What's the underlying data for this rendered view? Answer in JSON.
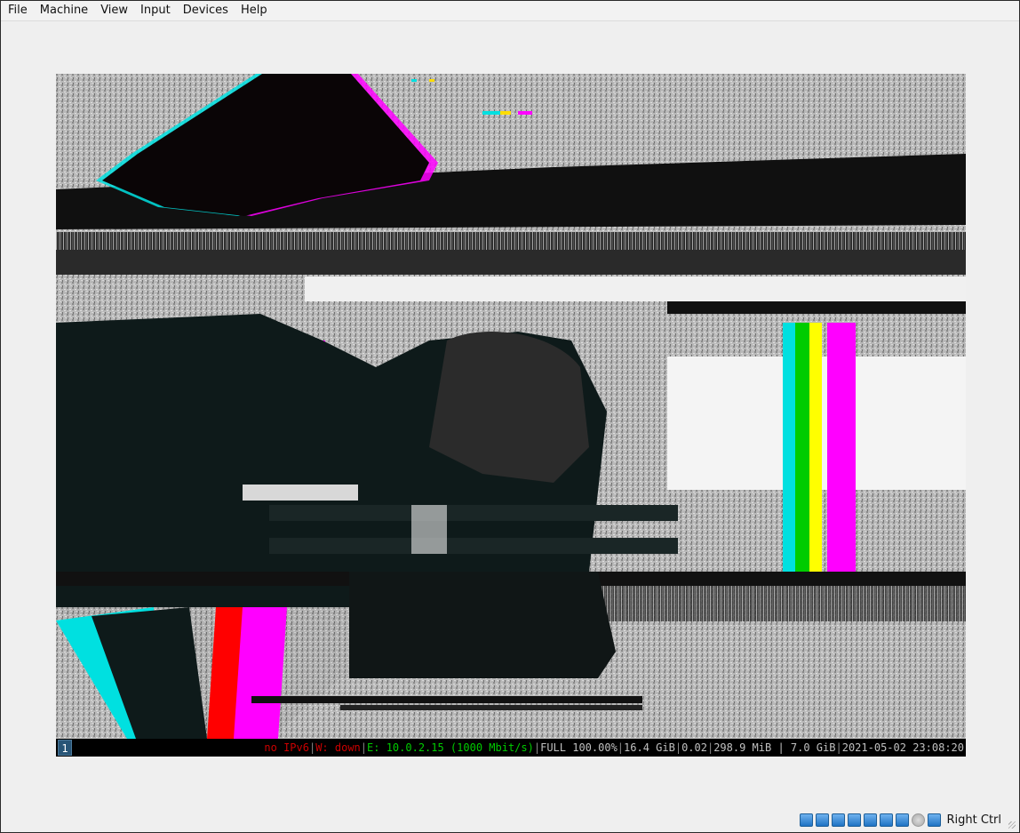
{
  "menubar": {
    "items": [
      "File",
      "Machine",
      "View",
      "Input",
      "Devices",
      "Help"
    ]
  },
  "vm_display": {
    "content": "glitch-art-wallpaper",
    "statusbar": {
      "workspace": "1",
      "ipv6": "no IPv6",
      "wireless": "W: down",
      "ethernet": "E: 10.0.2.15 (1000 Mbit/s)",
      "battery": "FULL 100.00%",
      "disk": "16.4 GiB",
      "load": "0.02",
      "memory": "298.9 MiB | 7.0 GiB",
      "datetime": "2021-05-02 23:08:20"
    }
  },
  "vbox_statusbar": {
    "icons": [
      "optical-drive-icon",
      "network-icon",
      "usb-icon",
      "shared-folders-icon",
      "display-icon",
      "video-capture-icon",
      "virtualization-icon",
      "mouse-integration-icon",
      "keyboard-capture-icon"
    ],
    "host_key": "Right Ctrl"
  },
  "colors": {
    "accent_workspace": "#285577",
    "status_error": "#cc0000",
    "status_ok": "#00cc00"
  }
}
